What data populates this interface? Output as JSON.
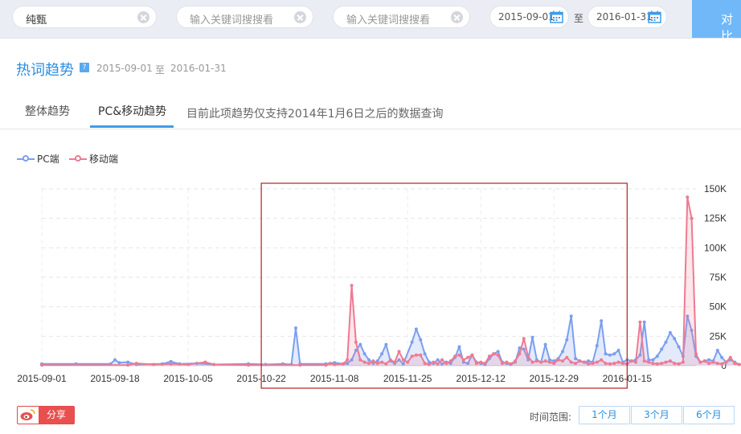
{
  "search": {
    "keyword1": "纯甄",
    "keyword2_placeholder": "输入关键词搜搜看",
    "keyword3_placeholder": "输入关键词搜搜看",
    "start_date": "2015-09-01",
    "end_date": "2016-01-31",
    "separator": "至",
    "compare_label": "对比"
  },
  "header": {
    "title": "热词趋势",
    "help": "?",
    "range_start": "2015-09-01",
    "range_sep": "至",
    "range_end": "2016-01-31"
  },
  "tabs": [
    {
      "label": "整体趋势",
      "active": false
    },
    {
      "label": "PC&移动趋势",
      "active": true
    }
  ],
  "tab_note": "目前此项趋势仅支持2014年1月6日之后的数据查询",
  "footer": {
    "share_label": "分享",
    "time_range_label": "时间范围:",
    "range_options": [
      "1个月",
      "3个月",
      "6个月"
    ]
  },
  "colors": {
    "pc": "#7b9ff0",
    "mobile": "#ee7a92",
    "accent": "#2a8ee0",
    "highlight_box": "#b22222"
  },
  "chart_data": {
    "type": "line",
    "x_ticks": [
      "2015-09-01",
      "2015-09-18",
      "2015-10-05",
      "2015-10-22",
      "2015-11-08",
      "2015-11-25",
      "2015-12-12",
      "2015-12-29",
      "2016-01-15"
    ],
    "y_ticks": [
      "0",
      "25K",
      "50K",
      "75K",
      "100K",
      "125K",
      "150K"
    ],
    "ylim": [
      0,
      150000
    ],
    "x_start": "2015-09-01",
    "x_end": "2016-01-31",
    "grid": true,
    "legend_position": "top-left",
    "highlight_range": [
      "2015-10-22",
      "2016-01-15"
    ],
    "series": [
      {
        "name": "PC端",
        "values": [
          [
            0,
            1500
          ],
          [
            8,
            1500
          ],
          [
            16,
            1500
          ],
          [
            17,
            5000
          ],
          [
            18,
            2500
          ],
          [
            20,
            3000
          ],
          [
            22,
            1000
          ],
          [
            28,
            1500
          ],
          [
            30,
            3500
          ],
          [
            32,
            1500
          ],
          [
            36,
            2000
          ],
          [
            40,
            1000
          ],
          [
            48,
            1500
          ],
          [
            52,
            1000
          ],
          [
            56,
            1500
          ],
          [
            58,
            1000
          ],
          [
            59,
            32000
          ],
          [
            60,
            1500
          ],
          [
            66,
            1500
          ],
          [
            68,
            2500
          ],
          [
            70,
            1500
          ],
          [
            71,
            2000
          ],
          [
            72,
            5000
          ],
          [
            73,
            13000
          ],
          [
            74,
            18000
          ],
          [
            75,
            10000
          ],
          [
            76,
            5000
          ],
          [
            77,
            2000
          ],
          [
            78,
            4000
          ],
          [
            79,
            10000
          ],
          [
            80,
            18000
          ],
          [
            81,
            4000
          ],
          [
            82,
            2000
          ],
          [
            83,
            5000
          ],
          [
            84,
            1500
          ],
          [
            86,
            20000
          ],
          [
            87,
            31000
          ],
          [
            88,
            22000
          ],
          [
            89,
            10000
          ],
          [
            90,
            3000
          ],
          [
            91,
            2000
          ],
          [
            92,
            5000
          ],
          [
            93,
            1500
          ],
          [
            94,
            3000
          ],
          [
            95,
            2000
          ],
          [
            96,
            7000
          ],
          [
            97,
            16000
          ],
          [
            98,
            3000
          ],
          [
            99,
            2000
          ],
          [
            100,
            9000
          ],
          [
            101,
            3000
          ],
          [
            102,
            2000
          ],
          [
            103,
            1000
          ],
          [
            104,
            6000
          ],
          [
            105,
            10000
          ],
          [
            106,
            12000
          ],
          [
            107,
            3000
          ],
          [
            108,
            2000
          ],
          [
            109,
            1000
          ],
          [
            110,
            3000
          ],
          [
            111,
            15000
          ],
          [
            112,
            14000
          ],
          [
            113,
            5000
          ],
          [
            114,
            24000
          ],
          [
            115,
            5000
          ],
          [
            116,
            3000
          ],
          [
            117,
            18000
          ],
          [
            118,
            5000
          ],
          [
            119,
            4000
          ],
          [
            120,
            6000
          ],
          [
            121,
            12000
          ],
          [
            122,
            22000
          ],
          [
            123,
            42000
          ],
          [
            124,
            6000
          ],
          [
            125,
            4000
          ],
          [
            126,
            3000
          ],
          [
            127,
            4000
          ],
          [
            128,
            3000
          ],
          [
            129,
            17000
          ],
          [
            130,
            38000
          ],
          [
            131,
            10000
          ],
          [
            132,
            9000
          ],
          [
            133,
            10000
          ],
          [
            134,
            13000
          ],
          [
            135,
            3000
          ],
          [
            136,
            5000
          ],
          [
            137,
            4000
          ],
          [
            138,
            5000
          ],
          [
            139,
            9000
          ],
          [
            140,
            37000
          ],
          [
            141,
            5000
          ],
          [
            142,
            5000
          ],
          [
            143,
            8000
          ],
          [
            144,
            14000
          ],
          [
            145,
            20000
          ],
          [
            146,
            28000
          ],
          [
            147,
            23000
          ],
          [
            148,
            16000
          ],
          [
            149,
            8000
          ],
          [
            150,
            42000
          ],
          [
            151,
            30000
          ],
          [
            152,
            8000
          ],
          [
            153,
            3000
          ],
          [
            154,
            4000
          ],
          [
            155,
            5000
          ],
          [
            156,
            4000
          ],
          [
            157,
            13000
          ],
          [
            158,
            7000
          ],
          [
            159,
            3000
          ],
          [
            160,
            5000
          ],
          [
            161,
            3000
          ],
          [
            162,
            1000
          ],
          [
            166,
            1000
          ],
          [
            170,
            1500
          ],
          [
            176,
            1000
          ],
          [
            182,
            1500
          ]
        ]
      },
      {
        "name": "移动端",
        "values": [
          [
            0,
            500
          ],
          [
            20,
            500
          ],
          [
            22,
            2000
          ],
          [
            26,
            1000
          ],
          [
            30,
            1500
          ],
          [
            34,
            1000
          ],
          [
            38,
            3000
          ],
          [
            40,
            1000
          ],
          [
            48,
            500
          ],
          [
            60,
            500
          ],
          [
            66,
            500
          ],
          [
            67,
            2000
          ],
          [
            68,
            1000
          ],
          [
            70,
            1500
          ],
          [
            71,
            5000
          ],
          [
            72,
            68000
          ],
          [
            73,
            20000
          ],
          [
            74,
            5000
          ],
          [
            75,
            3000
          ],
          [
            76,
            2000
          ],
          [
            77,
            4000
          ],
          [
            78,
            2000
          ],
          [
            79,
            3000
          ],
          [
            80,
            1500
          ],
          [
            81,
            5000
          ],
          [
            82,
            3000
          ],
          [
            83,
            12000
          ],
          [
            84,
            5000
          ],
          [
            85,
            3000
          ],
          [
            86,
            8000
          ],
          [
            87,
            9000
          ],
          [
            88,
            9000
          ],
          [
            89,
            2000
          ],
          [
            90,
            1000
          ],
          [
            91,
            3000
          ],
          [
            92,
            1500
          ],
          [
            93,
            5000
          ],
          [
            94,
            2000
          ],
          [
            95,
            4000
          ],
          [
            96,
            8000
          ],
          [
            97,
            9000
          ],
          [
            98,
            5000
          ],
          [
            99,
            7000
          ],
          [
            100,
            9000
          ],
          [
            101,
            2000
          ],
          [
            102,
            3000
          ],
          [
            103,
            2000
          ],
          [
            104,
            8000
          ],
          [
            105,
            10000
          ],
          [
            106,
            9000
          ],
          [
            107,
            2000
          ],
          [
            108,
            3000
          ],
          [
            109,
            1500
          ],
          [
            110,
            4000
          ],
          [
            111,
            10000
          ],
          [
            112,
            23000
          ],
          [
            113,
            8000
          ],
          [
            114,
            3000
          ],
          [
            115,
            4000
          ],
          [
            116,
            3000
          ],
          [
            117,
            4000
          ],
          [
            118,
            3000
          ],
          [
            119,
            2000
          ],
          [
            120,
            5000
          ],
          [
            121,
            4000
          ],
          [
            122,
            7000
          ],
          [
            123,
            3000
          ],
          [
            124,
            2000
          ],
          [
            125,
            4000
          ],
          [
            126,
            3000
          ],
          [
            127,
            1500
          ],
          [
            128,
            2000
          ],
          [
            129,
            3000
          ],
          [
            130,
            5000
          ],
          [
            131,
            2000
          ],
          [
            132,
            1500
          ],
          [
            133,
            2000
          ],
          [
            134,
            3000
          ],
          [
            135,
            2000
          ],
          [
            136,
            1500
          ],
          [
            137,
            4000
          ],
          [
            138,
            3000
          ],
          [
            139,
            37000
          ],
          [
            140,
            4000
          ],
          [
            141,
            3000
          ],
          [
            142,
            2000
          ],
          [
            143,
            1500
          ],
          [
            144,
            2000
          ],
          [
            145,
            3000
          ],
          [
            146,
            4000
          ],
          [
            147,
            2000
          ],
          [
            148,
            1500
          ],
          [
            149,
            3000
          ],
          [
            150,
            143000
          ],
          [
            151,
            125000
          ],
          [
            152,
            10000
          ],
          [
            153,
            3000
          ],
          [
            154,
            4000
          ],
          [
            155,
            2000
          ],
          [
            156,
            3000
          ],
          [
            157,
            2000
          ],
          [
            158,
            1500
          ],
          [
            159,
            3000
          ],
          [
            160,
            7000
          ],
          [
            161,
            2000
          ],
          [
            162,
            1000
          ],
          [
            166,
            500
          ],
          [
            170,
            500
          ],
          [
            176,
            500
          ],
          [
            182,
            500
          ]
        ]
      }
    ]
  }
}
